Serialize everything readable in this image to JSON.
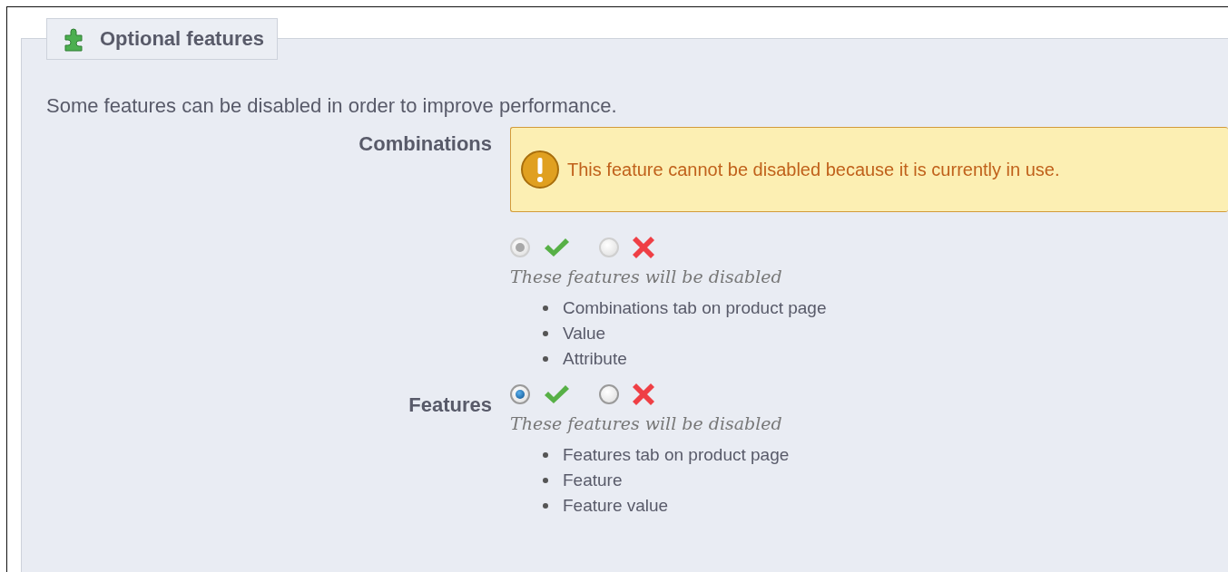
{
  "panel": {
    "title": "Optional features",
    "description": "Some features can be disabled in order to improve performance."
  },
  "features": [
    {
      "label": "Combinations",
      "warning": "This feature cannot be disabled because it is currently in use.",
      "disabled": true,
      "options": [
        {
          "kind": "yes",
          "selected": true
        },
        {
          "kind": "no",
          "selected": false
        }
      ],
      "note": "These features will be disabled",
      "items": [
        "Combinations tab on product page",
        "Value",
        "Attribute"
      ]
    },
    {
      "label": "Features",
      "disabled": false,
      "options": [
        {
          "kind": "yes",
          "selected": true
        },
        {
          "kind": "no",
          "selected": false
        }
      ],
      "note": "These features will be disabled",
      "items": [
        "Features tab on product page",
        "Feature",
        "Feature value"
      ]
    }
  ]
}
